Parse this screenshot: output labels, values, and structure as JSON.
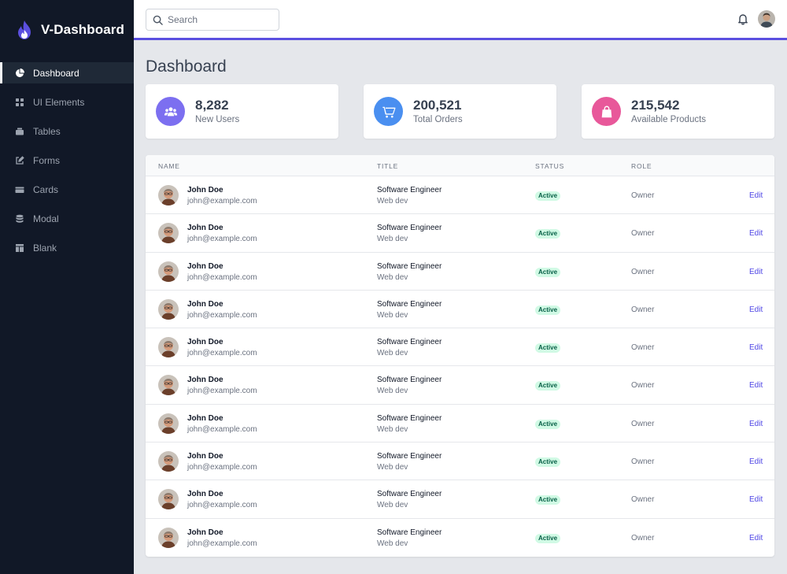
{
  "brand": {
    "name": "V-Dashboard"
  },
  "sidebar": {
    "items": [
      {
        "label": "Dashboard",
        "icon": "pie-chart-icon",
        "active": true
      },
      {
        "label": "UI Elements",
        "icon": "grid-icon",
        "active": false
      },
      {
        "label": "Tables",
        "icon": "table-icon",
        "active": false
      },
      {
        "label": "Forms",
        "icon": "edit-icon",
        "active": false
      },
      {
        "label": "Cards",
        "icon": "credit-card-icon",
        "active": false
      },
      {
        "label": "Modal",
        "icon": "database-icon",
        "active": false
      },
      {
        "label": "Blank",
        "icon": "layout-icon",
        "active": false
      }
    ]
  },
  "header": {
    "search_placeholder": "Search",
    "accent_color": "#5b4fe0"
  },
  "main": {
    "title": "Dashboard",
    "stats": [
      {
        "value": "8,282",
        "label": "New Users",
        "icon": "users-icon",
        "color": "#7c6ff0"
      },
      {
        "value": "200,521",
        "label": "Total Orders",
        "icon": "cart-icon",
        "color": "#4a8ff0"
      },
      {
        "value": "215,542",
        "label": "Available Products",
        "icon": "shopping-bag-icon",
        "color": "#e8589a"
      }
    ],
    "table": {
      "headers": [
        "Name",
        "Title",
        "Status",
        "Role"
      ],
      "rows": [
        {
          "name": "John Doe",
          "email": "john@example.com",
          "title": "Software Engineer",
          "subtitle": "Web dev",
          "status": "Active",
          "role": "Owner",
          "action": "Edit"
        },
        {
          "name": "John Doe",
          "email": "john@example.com",
          "title": "Software Engineer",
          "subtitle": "Web dev",
          "status": "Active",
          "role": "Owner",
          "action": "Edit"
        },
        {
          "name": "John Doe",
          "email": "john@example.com",
          "title": "Software Engineer",
          "subtitle": "Web dev",
          "status": "Active",
          "role": "Owner",
          "action": "Edit"
        },
        {
          "name": "John Doe",
          "email": "john@example.com",
          "title": "Software Engineer",
          "subtitle": "Web dev",
          "status": "Active",
          "role": "Owner",
          "action": "Edit"
        },
        {
          "name": "John Doe",
          "email": "john@example.com",
          "title": "Software Engineer",
          "subtitle": "Web dev",
          "status": "Active",
          "role": "Owner",
          "action": "Edit"
        },
        {
          "name": "John Doe",
          "email": "john@example.com",
          "title": "Software Engineer",
          "subtitle": "Web dev",
          "status": "Active",
          "role": "Owner",
          "action": "Edit"
        },
        {
          "name": "John Doe",
          "email": "john@example.com",
          "title": "Software Engineer",
          "subtitle": "Web dev",
          "status": "Active",
          "role": "Owner",
          "action": "Edit"
        },
        {
          "name": "John Doe",
          "email": "john@example.com",
          "title": "Software Engineer",
          "subtitle": "Web dev",
          "status": "Active",
          "role": "Owner",
          "action": "Edit"
        },
        {
          "name": "John Doe",
          "email": "john@example.com",
          "title": "Software Engineer",
          "subtitle": "Web dev",
          "status": "Active",
          "role": "Owner",
          "action": "Edit"
        },
        {
          "name": "John Doe",
          "email": "john@example.com",
          "title": "Software Engineer",
          "subtitle": "Web dev",
          "status": "Active",
          "role": "Owner",
          "action": "Edit"
        }
      ]
    }
  }
}
